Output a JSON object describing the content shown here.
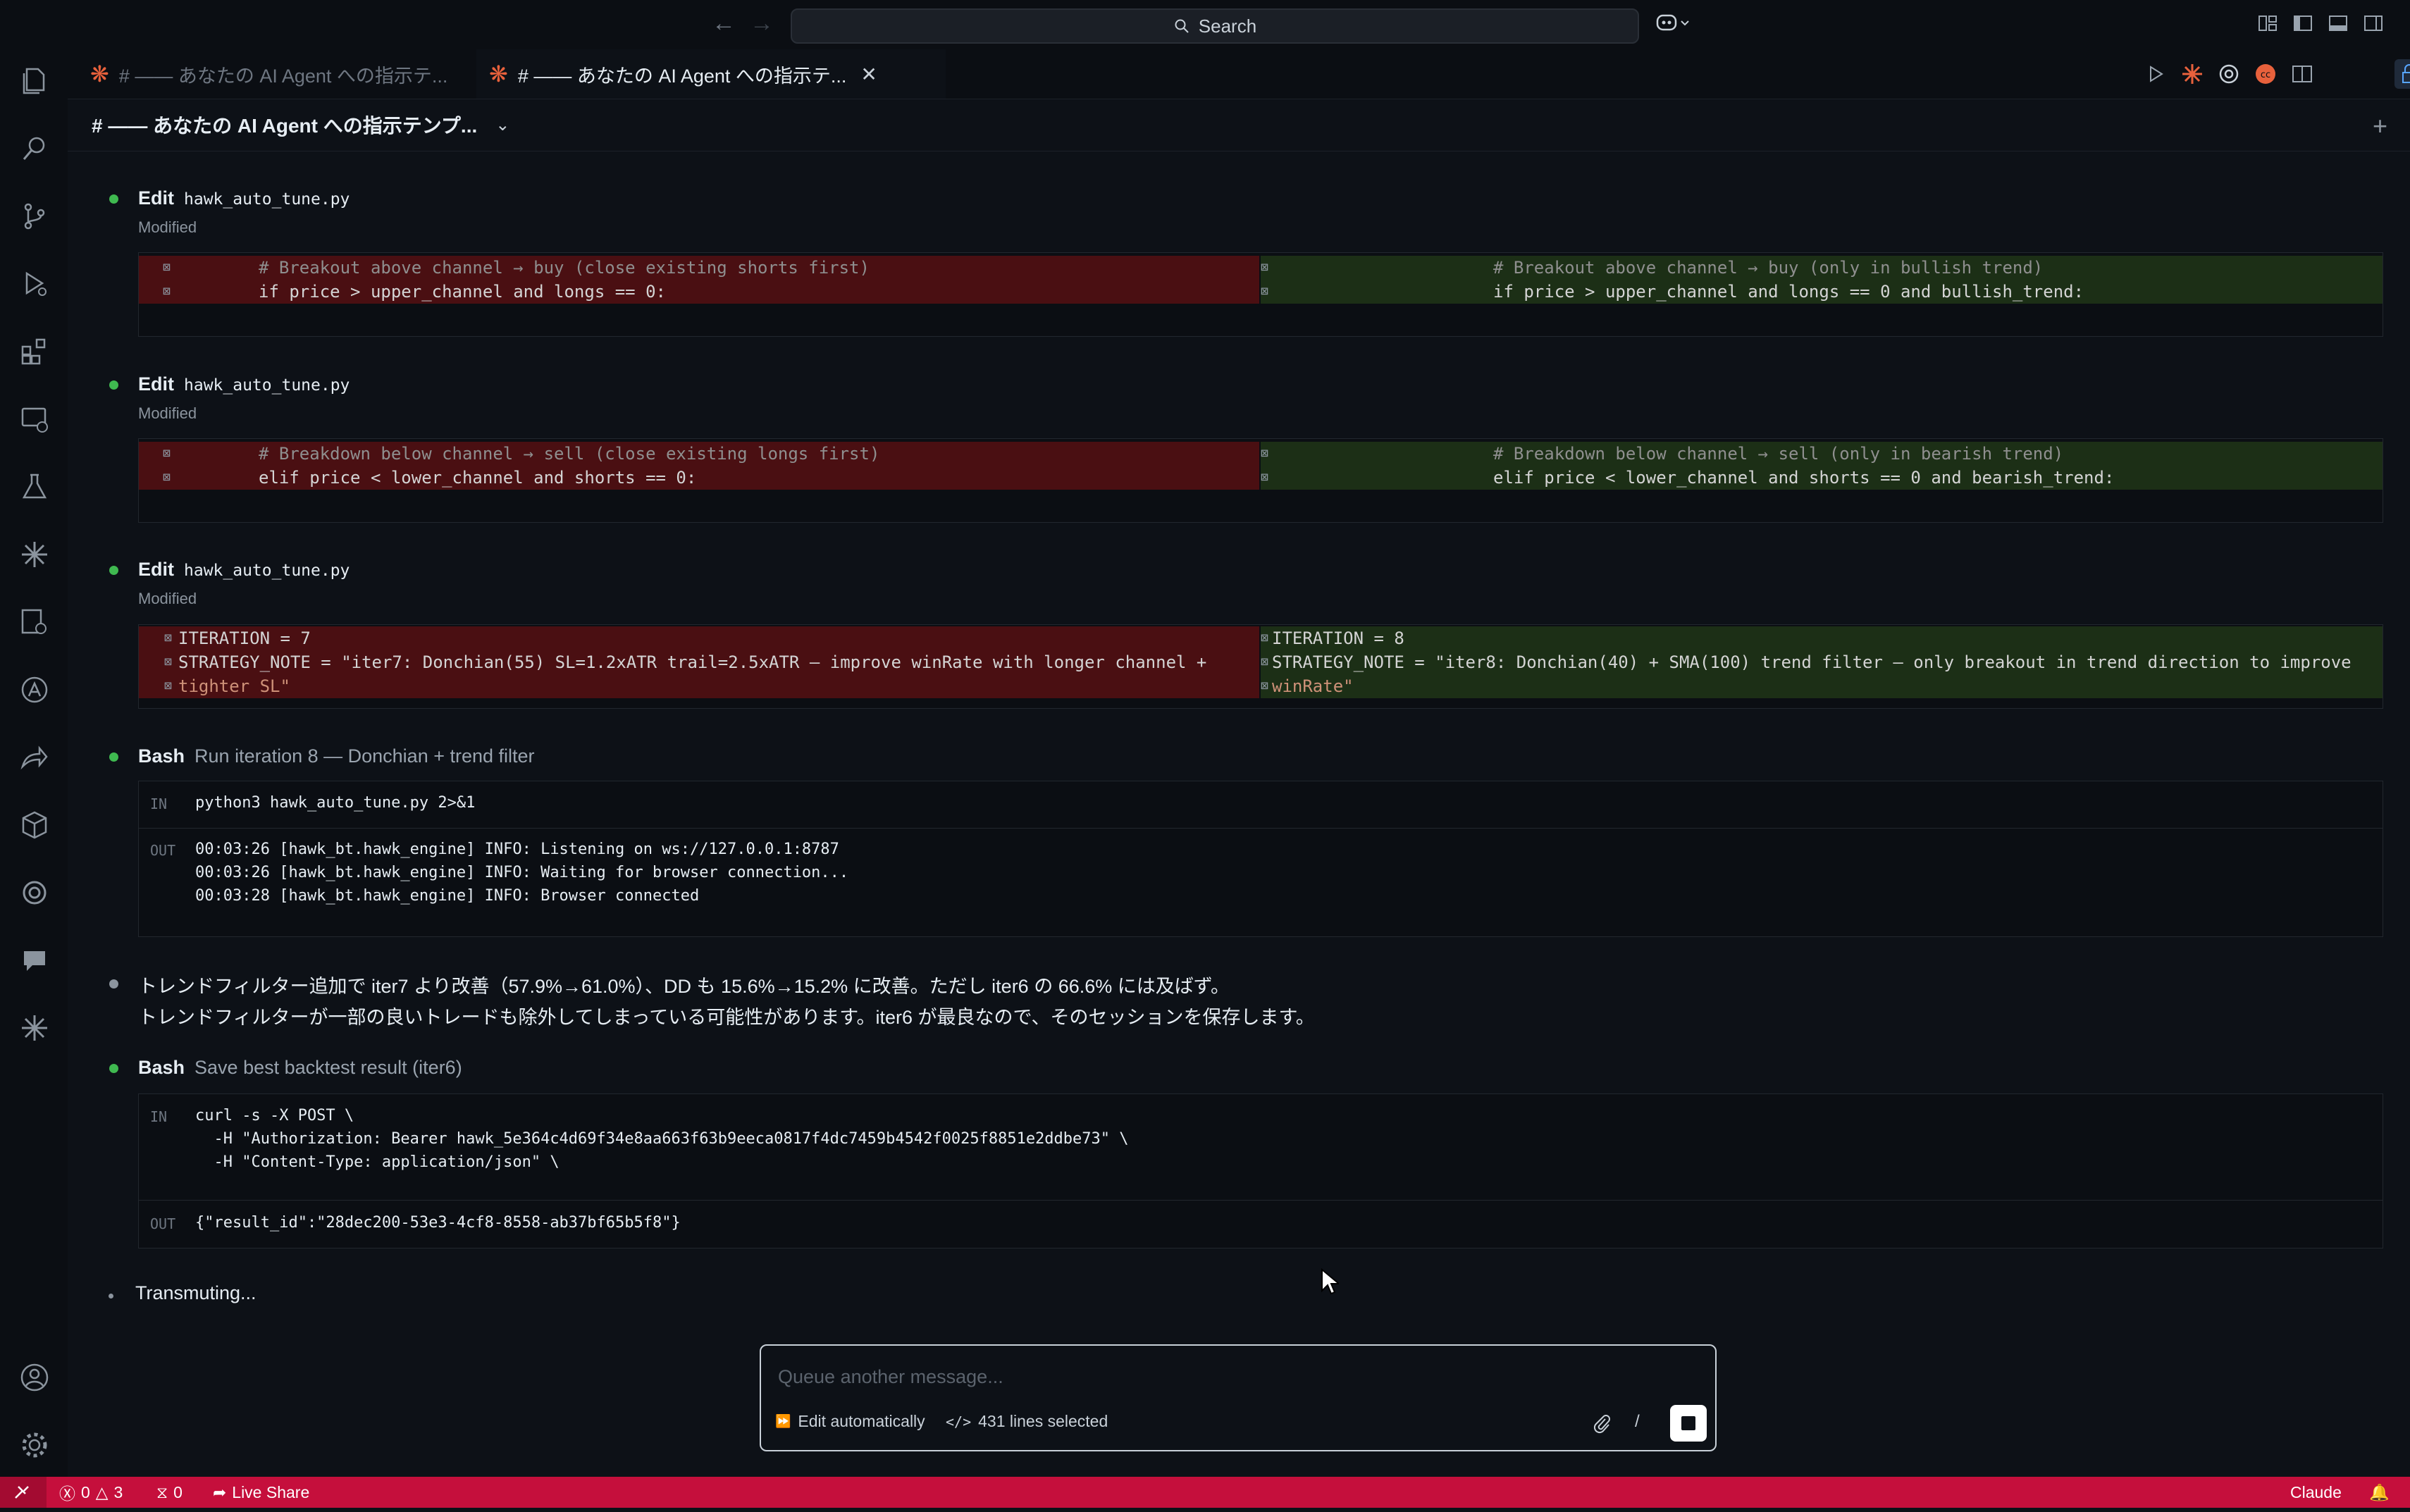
{
  "titlebar": {
    "search_label": "Search"
  },
  "tabs": [
    {
      "label": "# —— あなたの AI Agent への指示テ..."
    },
    {
      "label": "# —— あなたの AI Agent への指示テ..."
    }
  ],
  "breadcrumb": {
    "title": "# —— あなたの AI Agent への指示テンプ..."
  },
  "edits": [
    {
      "verb": "Edit",
      "file": "hawk_auto_tune.py",
      "status": "Modified"
    },
    {
      "verb": "Edit",
      "file": "hawk_auto_tune.py",
      "status": "Modified"
    },
    {
      "verb": "Edit",
      "file": "hawk_auto_tune.py",
      "status": "Modified"
    }
  ],
  "diff1": {
    "old": [
      "# Breakout above channel → buy (close existing shorts first)",
      "if price > upper_channel and longs == 0:"
    ],
    "new": [
      "# Breakout above channel → buy (only in bullish trend)",
      "if price > upper_channel and longs == 0 and bullish_trend:"
    ]
  },
  "diff2": {
    "old": [
      "# Breakdown below channel → sell (close existing longs first)",
      "elif price < lower_channel and shorts == 0:"
    ],
    "new": [
      "# Breakdown below channel → sell (only in bearish trend)",
      "elif price < lower_channel and shorts == 0 and bearish_trend:"
    ]
  },
  "diff3": {
    "old": [
      "ITERATION = 7",
      "STRATEGY_NOTE = \"iter7: Donchian(55) SL=1.2xATR trail=2.5xATR — improve winRate with longer channel +",
      "tighter SL\""
    ],
    "new": [
      "ITERATION = 8",
      "STRATEGY_NOTE = \"iter8: Donchian(40) + SMA(100) trend filter — only breakout in trend direction to improve",
      "winRate\""
    ]
  },
  "bash1": {
    "verb": "Bash",
    "desc": "Run iteration 8 — Donchian + trend filter",
    "in_label": "IN",
    "out_label": "OUT",
    "command": "python3 hawk_auto_tune.py 2>&1",
    "output": [
      "00:03:26 [hawk_bt.hawk_engine] INFO: Listening on ws://127.0.0.1:8787",
      "00:03:26 [hawk_bt.hawk_engine] INFO: Waiting for browser connection...",
      "00:03:28 [hawk_bt.hawk_engine] INFO: Browser connected"
    ]
  },
  "message": {
    "line1": "トレンドフィルター追加で iter7 より改善（57.9%→61.0%）、DD も 15.6%→15.2% に改善。ただし iter6 の 66.6% には及ばず。",
    "line2": "トレンドフィルターが一部の良いトレードも除外してしまっている可能性があります。iter6 が最良なので、そのセッションを保存します。"
  },
  "bash2": {
    "verb": "Bash",
    "desc": "Save best backtest result (iter6)",
    "in_label": "IN",
    "out_label": "OUT",
    "command": [
      "curl -s -X POST \\",
      "  -H \"Authorization: Bearer hawk_5e364c4d69f34e8aa663f63b9eeca0817f4dc7459b4542f0025f8851e2ddbe73\" \\",
      "  -H \"Content-Type: application/json\" \\"
    ],
    "output": "{\"result_id\":\"28dec200-53e3-4cf8-8558-ab37bf65b5f8\"}"
  },
  "status_text": "Transmuting...",
  "composer": {
    "placeholder": "Queue another message...",
    "mode_label": "Edit automatically",
    "selection_label": "431 lines selected",
    "slash": "/"
  },
  "statusbar": {
    "errors": "0",
    "warnings": "3",
    "ports": "0",
    "live_share": "Live Share",
    "claude": "Claude"
  },
  "colors": {
    "accent": "#c50f3c",
    "success_dot": "#3fb950",
    "diff_removed": "#4a0f12",
    "diff_added": "#1c2f16"
  }
}
